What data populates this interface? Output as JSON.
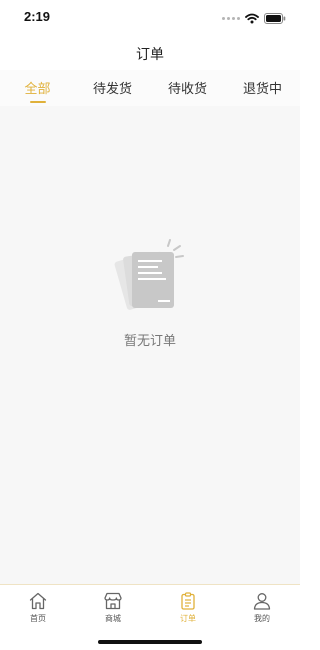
{
  "status_bar": {
    "time": "2:19",
    "icons": [
      "cellular-dots-icon",
      "wifi-icon",
      "battery-icon"
    ]
  },
  "nav": {
    "title": "订单"
  },
  "tabs": [
    {
      "label": "全部",
      "active": true
    },
    {
      "label": "待发货",
      "active": false
    },
    {
      "label": "待收货",
      "active": false
    },
    {
      "label": "退货中",
      "active": false
    }
  ],
  "empty_state": {
    "message": "暂无订单",
    "icon": "empty-order-documents-icon"
  },
  "tab_bar": {
    "items": [
      {
        "label": "首页",
        "icon": "home-icon",
        "active": false
      },
      {
        "label": "商城",
        "icon": "store-icon",
        "active": false
      },
      {
        "label": "订单",
        "icon": "order-clipboard-icon",
        "active": true
      },
      {
        "label": "我的",
        "icon": "user-icon",
        "active": false
      }
    ]
  },
  "colors": {
    "accent": "#e0b13a",
    "background": "#f7f7f7",
    "text": "#333333",
    "muted_text": "#777777"
  }
}
